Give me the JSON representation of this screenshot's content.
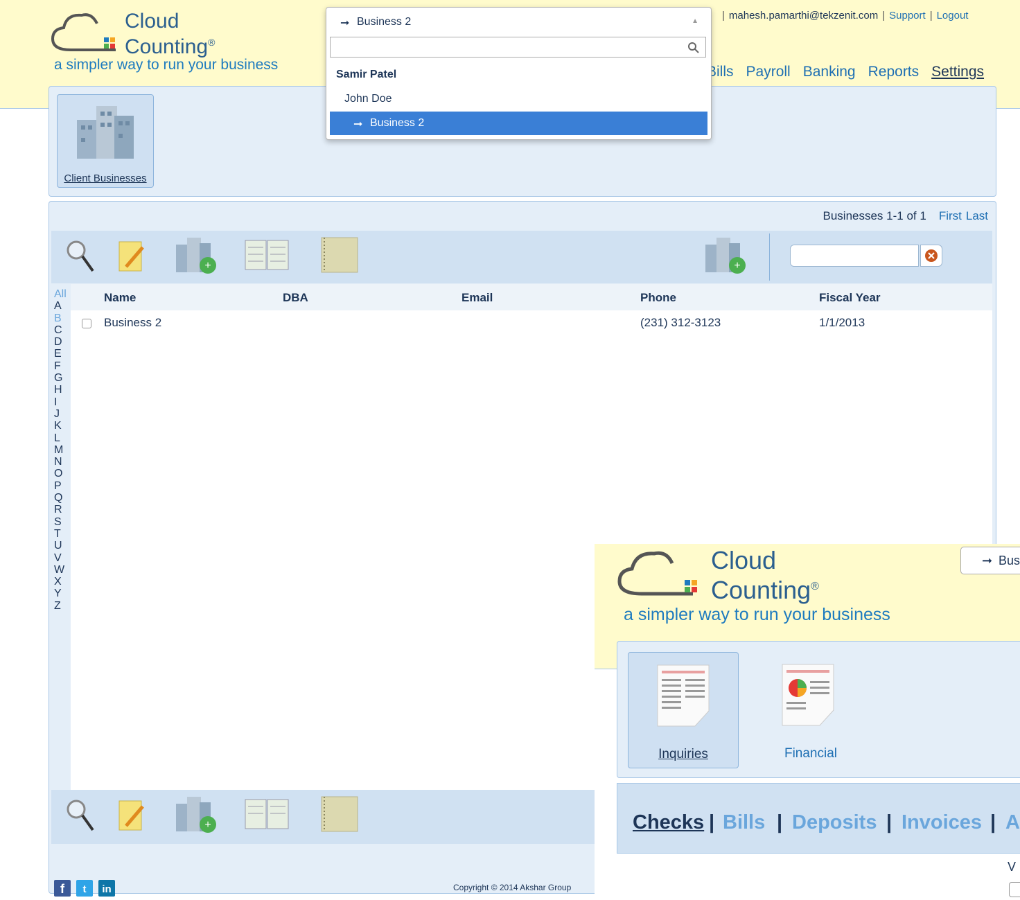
{
  "brand": {
    "line1": "Cloud",
    "line2": "Counting",
    "reg": "®",
    "tagline": "a simpler way to run your business"
  },
  "topbar": {
    "user": "mahesh.pamarthi@tekzenit.com",
    "support": "Support",
    "logout": "Logout"
  },
  "nav": {
    "bills": "Bills",
    "payroll": "Payroll",
    "banking": "Banking",
    "reports": "Reports",
    "settings": "Settings"
  },
  "dropdown": {
    "selected": "Business 2",
    "search_value": "",
    "options": [
      {
        "label": "Samir Patel",
        "type": "group"
      },
      {
        "label": "John Doe",
        "type": "item"
      },
      {
        "label": "Business 2",
        "type": "selected"
      }
    ]
  },
  "module": {
    "label": "Client Businesses"
  },
  "pager": {
    "text": "Businesses 1-1 of 1",
    "first": "First",
    "last": "Last"
  },
  "alphabet": [
    "All",
    "A",
    "B",
    "C",
    "D",
    "E",
    "F",
    "G",
    "H",
    "I",
    "J",
    "K",
    "L",
    "M",
    "N",
    "O",
    "P",
    "Q",
    "R",
    "S",
    "T",
    "U",
    "V",
    "W",
    "X",
    "Y",
    "Z"
  ],
  "table": {
    "columns": [
      "Name",
      "DBA",
      "Email",
      "Phone",
      "Fiscal Year"
    ],
    "rows": [
      {
        "name": "Business 2",
        "dba": "",
        "email": "",
        "phone": "(231) 312-3123",
        "fiscal_year": "1/1/2013"
      }
    ]
  },
  "footer": {
    "copyright": "Copyright © 2014 Akshar Group"
  },
  "overlay": {
    "brand": {
      "line1": "Cloud",
      "line2": "Counting",
      "reg": "®",
      "tagline": "a simpler way to run your business"
    },
    "selector": "Bus",
    "modules": [
      "Inquiries",
      "Financial"
    ],
    "tabs": [
      "Checks",
      "Bills",
      "Deposits",
      "Invoices",
      "A"
    ],
    "partial_label": "V"
  },
  "colors": {
    "header_bg": "#fffbcc",
    "panel_bg": "#e4eef8",
    "highlight": "#3a7fd6",
    "link": "#1e6fb3"
  }
}
